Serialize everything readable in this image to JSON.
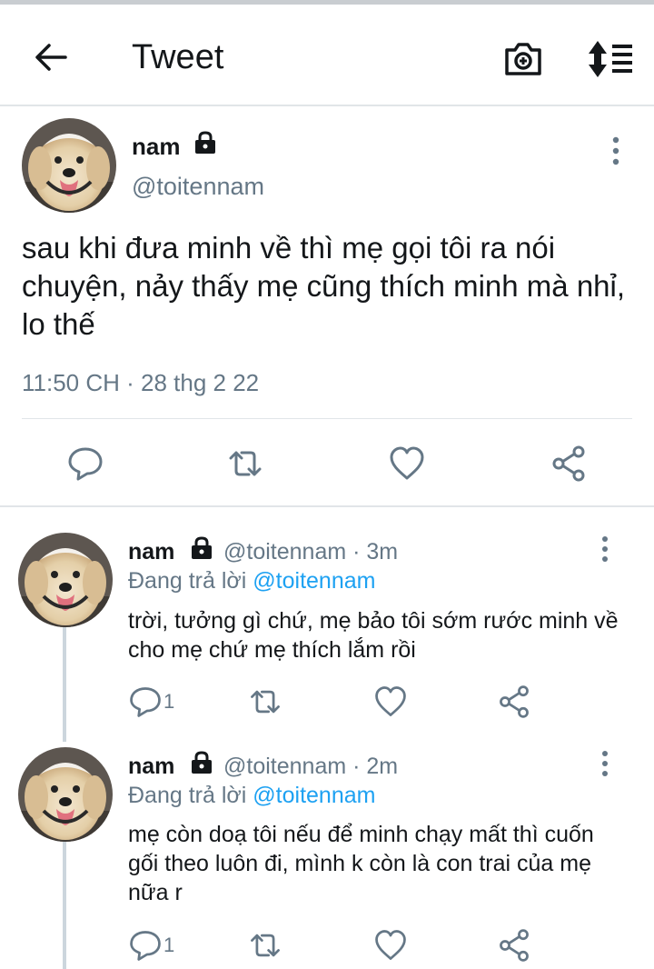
{
  "header": {
    "title": "Tweet"
  },
  "icons": {
    "back": "arrow-left-icon",
    "camera": "camera-add-icon",
    "sort": "sort-icon",
    "more": "more-vertical-icon",
    "reply": "reply-icon",
    "retweet": "retweet-icon",
    "like": "heart-icon",
    "share": "share-icon",
    "lock": "lock-icon"
  },
  "colors": {
    "link": "#1da1f2",
    "secondary": "#657786",
    "primary": "#14171a",
    "divider": "#e1e5e8"
  },
  "main_tweet": {
    "name": "nam",
    "handle": "@toitennam",
    "text": "sau khi đưa minh về thì mẹ gọi tôi ra nói chuyện, nảy thấy mẹ cũng thích minh mà nhỉ, lo thế",
    "timestamp": "11:50 CH · 28 thg 2 22"
  },
  "replies": [
    {
      "name": "nam",
      "handle_time": "@toitennam · 3m",
      "replying_prefix": "Đang trả lời ",
      "replying_to": "@toitennam",
      "text": "trời, tưởng gì chứ, mẹ bảo tôi sớm rước minh về cho mẹ chứ mẹ thích lắm rồi",
      "reply_count": "1"
    },
    {
      "name": "nam",
      "handle_time": "@toitennam · 2m",
      "replying_prefix": "Đang trả lời ",
      "replying_to": "@toitennam",
      "text": "mẹ còn doạ tôi nếu để minh chạy mất thì cuốn gối theo luôn đi, mình k còn là con trai của mẹ nữa r",
      "reply_count": "1"
    }
  ]
}
